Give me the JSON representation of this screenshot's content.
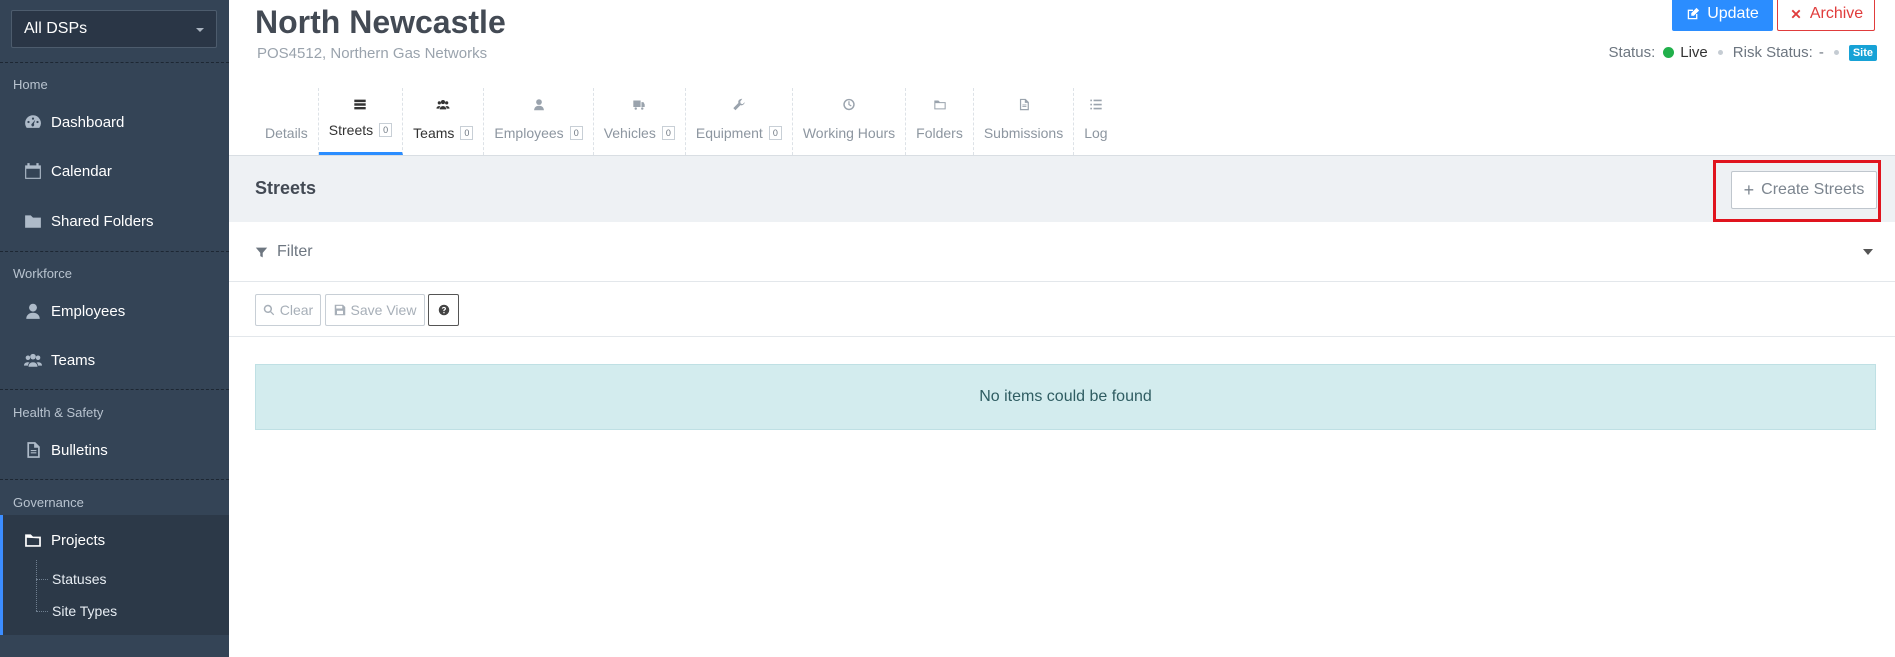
{
  "sidebar": {
    "dsp_select": "All DSPs",
    "sections": {
      "home": "Home",
      "workforce": "Workforce",
      "health_safety": "Health & Safety",
      "governance": "Governance"
    },
    "items": {
      "dashboard": "Dashboard",
      "calendar": "Calendar",
      "shared_folders": "Shared Folders",
      "employees": "Employees",
      "teams": "Teams",
      "bulletins": "Bulletins",
      "projects": "Projects",
      "statuses": "Statuses",
      "site_types": "Site Types"
    },
    "icons": {
      "dashboard": "gauge-icon",
      "calendar": "calendar-icon",
      "shared_folders": "folder-icon",
      "employees": "user-icon",
      "teams": "users-icon",
      "bulletins": "document-icon",
      "projects": "folder-open-icon"
    }
  },
  "header": {
    "title": "North Newcastle",
    "subtitle": "POS4512, Northern Gas Networks",
    "update_label": "Update",
    "archive_label": "Archive",
    "status_label": "Status:",
    "status_value": "Live",
    "risk_label": "Risk Status:",
    "risk_value": "-",
    "site_badge": "Site",
    "colors": {
      "primary": "#2b8dff",
      "danger": "#e03c3c",
      "live": "#21b04b"
    }
  },
  "tabs": [
    {
      "label": "Details",
      "count": null,
      "icon": null
    },
    {
      "label": "Streets",
      "count": "0",
      "icon": "road-icon"
    },
    {
      "label": "Teams",
      "count": "0",
      "icon": "users-icon"
    },
    {
      "label": "Employees",
      "count": "0",
      "icon": "user-icon"
    },
    {
      "label": "Vehicles",
      "count": "0",
      "icon": "truck-icon"
    },
    {
      "label": "Equipment",
      "count": "0",
      "icon": "wrench-icon"
    },
    {
      "label": "Working Hours",
      "count": null,
      "icon": "clock-icon"
    },
    {
      "label": "Folders",
      "count": null,
      "icon": "folder-icon"
    },
    {
      "label": "Submissions",
      "count": null,
      "icon": "file-icon"
    },
    {
      "label": "Log",
      "count": null,
      "icon": "list-icon"
    }
  ],
  "panel": {
    "title": "Streets",
    "create_label": "Create Streets",
    "filter_label": "Filter",
    "clear_label": "Clear",
    "save_view_label": "Save View",
    "empty_message": "No items could be found"
  }
}
